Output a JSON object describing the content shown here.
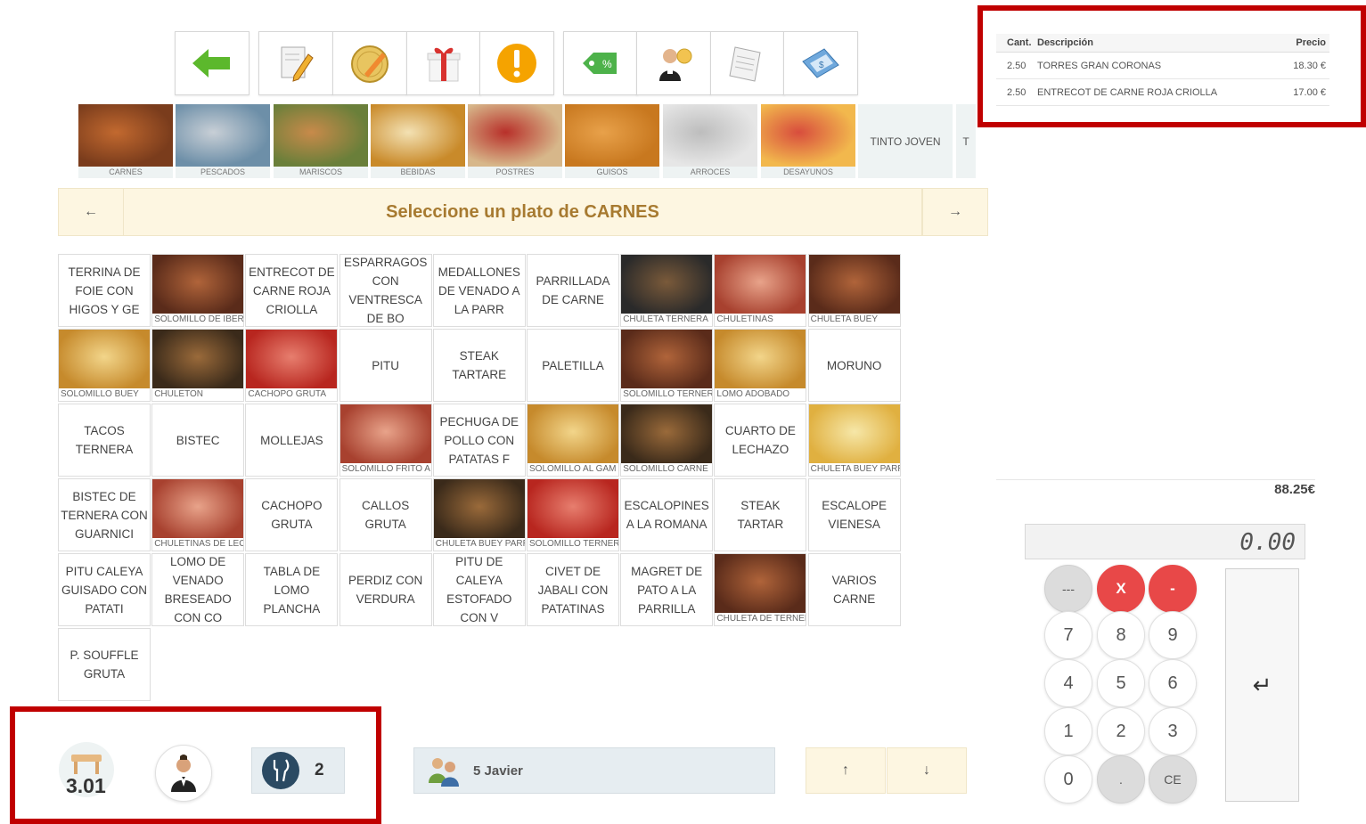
{
  "toolbar": {
    "icons": [
      "back-arrow-icon",
      "edit-icon",
      "discount-coin-icon",
      "gift-icon",
      "alert-icon",
      "price-tag-icon",
      "waiter-coins-icon",
      "receipt-icon",
      "invoice-icon"
    ]
  },
  "categories": [
    {
      "label": "CARNES"
    },
    {
      "label": "PESCADOS"
    },
    {
      "label": "MARISCOS"
    },
    {
      "label": "BEBIDAS"
    },
    {
      "label": "POSTRES"
    },
    {
      "label": "GUISOS"
    },
    {
      "label": "ARROCES"
    },
    {
      "label": "DESAYUNOS"
    },
    {
      "label": "TINTO JOVEN"
    },
    {
      "label": "T"
    }
  ],
  "header": {
    "title": "Seleccione un plato de CARNES",
    "prev": "←",
    "next": "→"
  },
  "dishes": [
    {
      "text": "TERRINA DE FOIE CON HIGOS Y GE",
      "img": false
    },
    {
      "text": "SOLOMILLO DE IBER",
      "img": true
    },
    {
      "text": "ENTRECOT DE CARNE ROJA CRIOLLA",
      "img": false
    },
    {
      "text": "ESPARRAGOS CON VENTRESCA DE BO",
      "img": false
    },
    {
      "text": "MEDALLONES DE VENADO A LA PARR",
      "img": false
    },
    {
      "text": "PARRILLADA DE CARNE",
      "img": false
    },
    {
      "text": "CHULETA TERNERA",
      "img": true
    },
    {
      "text": "CHULETINAS",
      "img": true
    },
    {
      "text": "CHULETA BUEY",
      "img": true
    },
    {
      "text": "SOLOMILLO BUEY",
      "img": true
    },
    {
      "text": "CHULETON",
      "img": true
    },
    {
      "text": "CACHOPO GRUTA",
      "img": true
    },
    {
      "text": "PITU",
      "img": false
    },
    {
      "text": "STEAK TARTARE",
      "img": false
    },
    {
      "text": "PALETILLA",
      "img": false
    },
    {
      "text": "SOLOMILLO TERNER",
      "img": true
    },
    {
      "text": "LOMO ADOBADO",
      "img": true
    },
    {
      "text": "MORUNO",
      "img": false
    },
    {
      "text": "TACOS TERNERA",
      "img": false
    },
    {
      "text": "BISTEC",
      "img": false
    },
    {
      "text": "MOLLEJAS",
      "img": false
    },
    {
      "text": "SOLOMILLO FRITO A",
      "img": true
    },
    {
      "text": "PECHUGA DE POLLO CON PATATAS F",
      "img": false
    },
    {
      "text": "SOLOMILLO AL GAM",
      "img": true
    },
    {
      "text": "SOLOMILLO CARNE",
      "img": true
    },
    {
      "text": "CUARTO DE LECHAZO",
      "img": false
    },
    {
      "text": "CHULETA BUEY PARRILLA S/P",
      "img": true
    },
    {
      "text": "BISTEC DE TERNERA CON GUARNICI",
      "img": false
    },
    {
      "text": "CHULETINAS DE LEC",
      "img": true
    },
    {
      "text": "CACHOPO GRUTA",
      "img": false
    },
    {
      "text": "CALLOS GRUTA",
      "img": false
    },
    {
      "text": "CHULETA BUEY PARR",
      "img": true
    },
    {
      "text": "SOLOMILLO TERNER",
      "img": true
    },
    {
      "text": "ESCALOPINES A LA ROMANA",
      "img": false
    },
    {
      "text": "STEAK TARTAR",
      "img": false
    },
    {
      "text": "ESCALOPE VIENESA",
      "img": false
    },
    {
      "text": "PITU CALEYA GUISADO CON PATATI",
      "img": false
    },
    {
      "text": "LOMO DE VENADO BRESEADO CON CO",
      "img": false
    },
    {
      "text": "TABLA DE LOMO PLANCHA",
      "img": false
    },
    {
      "text": "PERDIZ CON VERDURA",
      "img": false
    },
    {
      "text": "PITU DE CALEYA ESTOFADO CON V",
      "img": false
    },
    {
      "text": "CIVET DE JABALI CON PATATINAS",
      "img": false
    },
    {
      "text": "MAGRET DE PATO A LA PARRILLA",
      "img": false
    },
    {
      "text": "CHULETA DE TERNER",
      "img": true
    },
    {
      "text": "VARIOS CARNE",
      "img": false
    },
    {
      "text": "P. SOUFFLE GRUTA",
      "img": false
    }
  ],
  "ticket": {
    "headers": {
      "qty": "Cant.",
      "desc": "Descripción",
      "price": "Precio"
    },
    "rows": [
      {
        "qty": "2.50",
        "desc": "TORRES GRAN CORONAS",
        "price": "18.30 €"
      },
      {
        "qty": "2.50",
        "desc": "ENTRECOT DE CARNE ROJA CRIOLLA",
        "price": "17.00 €"
      }
    ],
    "total": "88.25€"
  },
  "keypad": {
    "display": "0.00",
    "keys": [
      "---",
      "X",
      "-",
      "7",
      "8",
      "9",
      "4",
      "5",
      "6",
      "1",
      "2",
      "3",
      "0",
      ".",
      "CE"
    ],
    "enter": "↵"
  },
  "bottom": {
    "table_number": "3.01",
    "covers": "2",
    "waiter": "5 Javier",
    "up": "↑",
    "down": "↓"
  },
  "colors": {
    "accent_red": "#c00000",
    "key_red": "#e84848",
    "title": "#a77a30"
  }
}
